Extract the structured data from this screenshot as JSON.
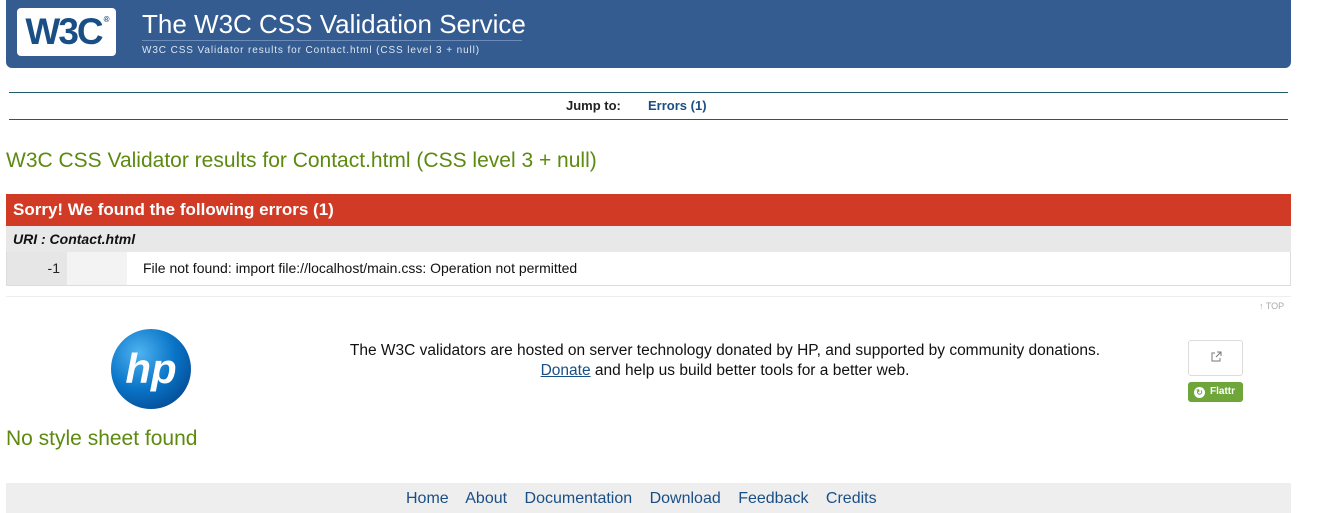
{
  "header": {
    "logo_text": "W3C",
    "logo_mark": "®",
    "title": "The W3C CSS Validation Service",
    "subtitle": "W3C CSS Validator results for Contact.html (CSS level 3 + null)"
  },
  "jump": {
    "label": "Jump to:",
    "errors_link": "Errors (1)"
  },
  "results": {
    "heading": "W3C CSS Validator results for Contact.html (CSS level 3 + null)",
    "errors_banner": "Sorry! We found the following errors (1)",
    "uri_line": "URI : Contact.html",
    "errors": [
      {
        "line": "-1",
        "context": "",
        "message": "File not found: import file://localhost/main.css: Operation not permitted"
      }
    ],
    "top_link": "↑ TOP"
  },
  "sponsor": {
    "logo_text": "hp",
    "line1": "The W3C validators are hosted on server technology donated by HP, and supported by community donations.",
    "donate_label": "Donate",
    "line2_rest": " and help us build better tools for a better web.",
    "flattr_label": "Flattr"
  },
  "style_sheet_status": "No style sheet found",
  "footer": {
    "links": [
      "Home",
      "About",
      "Documentation",
      "Download",
      "Feedback",
      "Credits"
    ]
  },
  "colors": {
    "banner": "#355c91",
    "heading_green": "#5c8a0f",
    "error_red": "#d13b25",
    "link_blue": "#1a4f86",
    "flattr_green": "#6ea63a"
  }
}
